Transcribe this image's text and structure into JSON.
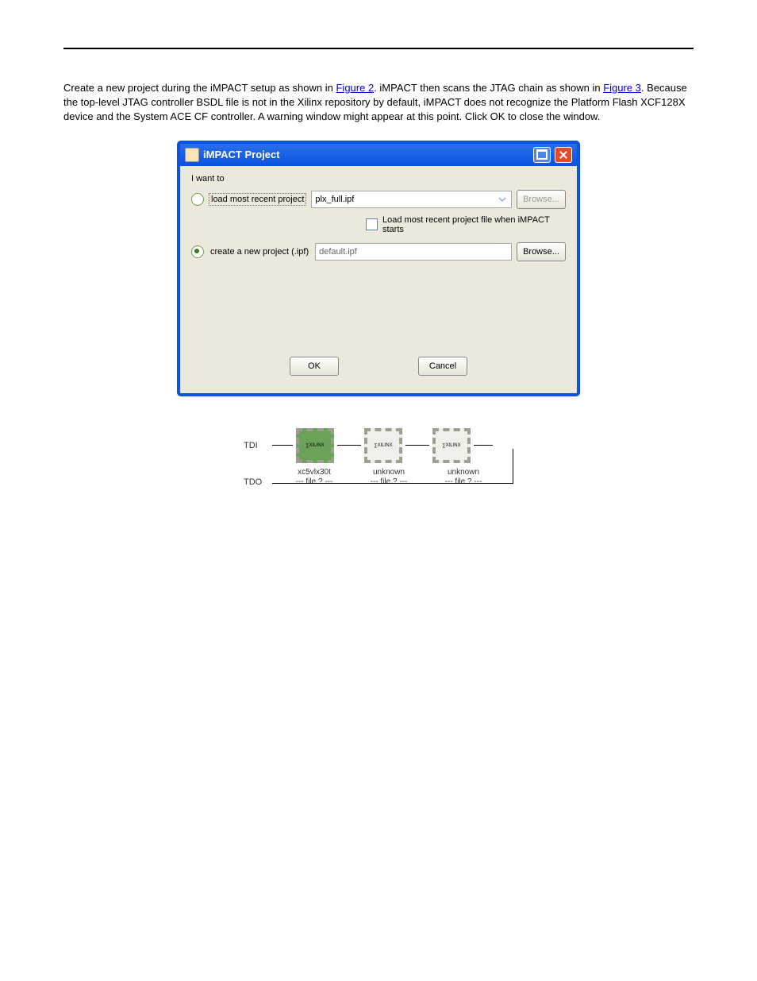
{
  "text": {
    "p1a": "Create a new project during the iMPACT setup as shown in ",
    "link1": "Figure 2",
    "p1b": " iMPACT then scans the JTAG chain as shown in ",
    "link2": "Figure 3",
    "p1c": " Because the top-level JTAG controller BSDL file is not in the Xilinx repository by default, iMPACT does not recognize the Platform Flash XCF128X device and the System ACE CF controller. A warning window might appear at this point. Click OK to close the window."
  },
  "dialog": {
    "title": "iMPACT Project",
    "prompt": "I want to",
    "opt1": "load most recent project",
    "opt1_value": "plx_full.ipf",
    "checkbox_text": "Load most recent project file when iMPACT starts",
    "opt2": "create a new project (.ipf)",
    "opt2_value": "default.ipf",
    "browse": "Browse...",
    "ok": "OK",
    "cancel": "Cancel"
  },
  "chain": {
    "tdi": "TDI",
    "tdo": "TDO",
    "chip_logo": "∑XILINX",
    "chips": [
      {
        "name": "xc5vlx30t",
        "sub": "--- file ? ---"
      },
      {
        "name": "unknown",
        "sub": "--- file ? ---"
      },
      {
        "name": "unknown",
        "sub": "--- file ? ---"
      }
    ]
  }
}
